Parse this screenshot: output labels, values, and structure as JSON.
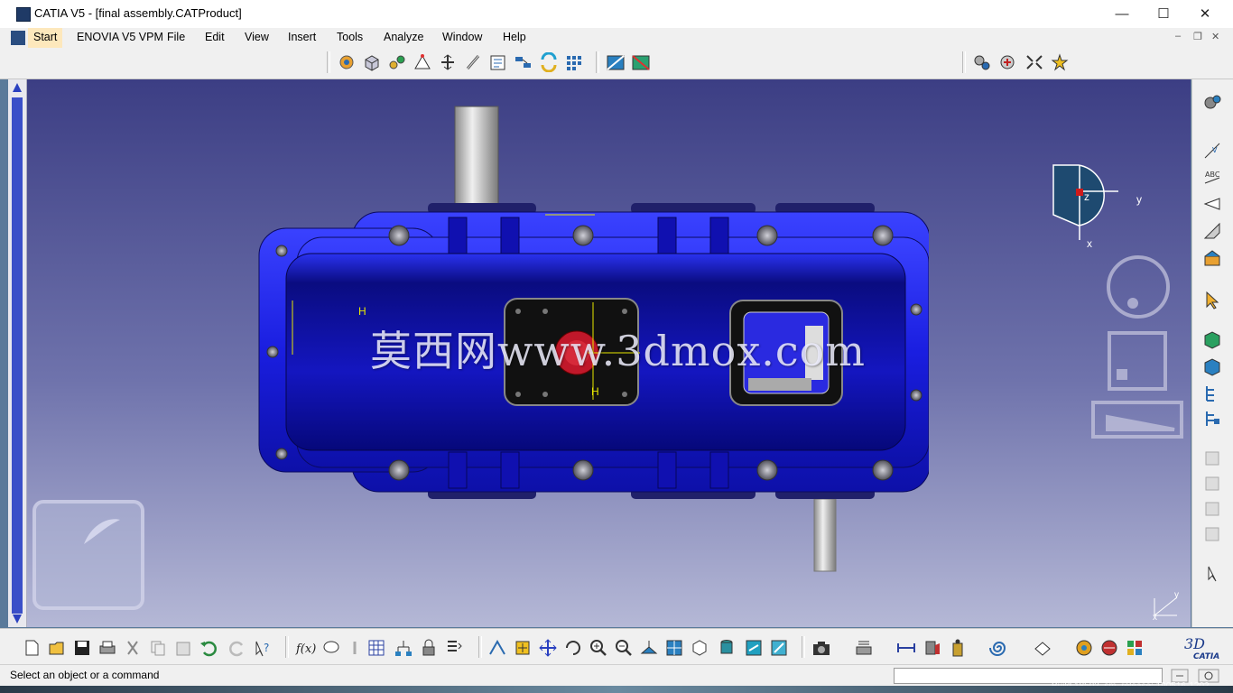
{
  "window": {
    "title": "CATIA V5 - [final assembly.CATProduct]",
    "controls": {
      "minimize": "—",
      "maximize": "☐",
      "close": "✕"
    }
  },
  "menu": {
    "items": [
      "Start",
      "ENOVIA V5 VPM",
      "File",
      "Edit",
      "View",
      "Insert",
      "Tools",
      "Analyze",
      "Window",
      "Help"
    ],
    "active": "Start",
    "doc_controls": {
      "minimize": "–",
      "restore": "❐",
      "close": "✕"
    }
  },
  "viewport": {
    "watermark": "莫西网www.3dmox.com",
    "compass_axes": {
      "x": "x",
      "y": "y",
      "z": "z"
    },
    "corner_axes": {
      "x": "x",
      "y": "y"
    },
    "dim_labels": [
      "H",
      "H"
    ],
    "colors": {
      "housing": "#1a1ee0",
      "housing_dark": "#0a0c80",
      "background_top": "#3c3e84",
      "background_bottom": "#b5b8d6",
      "bolt": "#7a7a88",
      "shaft": "#c8c8c8",
      "plug": "#c0182a"
    }
  },
  "status": {
    "message": "Select an object or a command",
    "build_text": "Build 18502, sm_release: 190516-1202"
  },
  "toolbars": {
    "top_icons": [
      "product-icon",
      "part-icon",
      "existing-component-icon",
      "snap-icon",
      "explode-icon",
      "constraint-icon",
      "catalog-icon",
      "scene-icon",
      "reorder-icon",
      "multi-instantiate-icon",
      "sweep-icon",
      "clash-icon"
    ],
    "bottom_icons": [
      "new-icon",
      "open-icon",
      "save-icon",
      "print-icon",
      "cut-icon",
      "copy-icon",
      "paste-icon",
      "undo-icon",
      "redo-icon",
      "whats-this-icon",
      "formula-icon",
      "comment-icon",
      "measure-icon",
      "table-icon",
      "tree-icon",
      "lock-icon",
      "catalog-icon",
      "fly-icon",
      "fit-all-icon",
      "pan-icon",
      "rotate-icon",
      "zoom-in-icon",
      "zoom-out-icon",
      "normal-view-icon",
      "multi-view-icon",
      "iso-view-icon",
      "shading-icon",
      "hide-show-icon",
      "swap-space-icon",
      "capture-icon",
      "analysis-icon",
      "measure-between-icon",
      "section-icon",
      "inertia-icon",
      "spiral-icon",
      "material-icon",
      "render-icon",
      "texture-icon",
      "catalog-browser-icon"
    ]
  }
}
